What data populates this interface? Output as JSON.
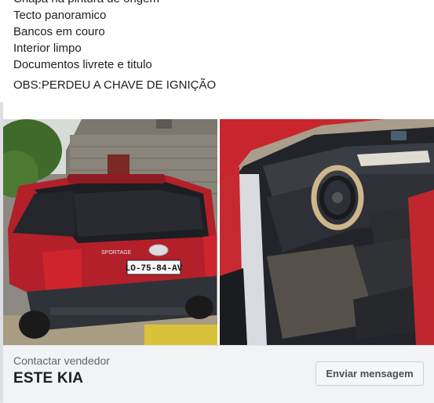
{
  "post": {
    "description_lines": [
      "Chapa na pintura de origem",
      "Tecto panoramico",
      "Bancos em couro",
      "Interior limpo",
      "Documentos livrete e titulo"
    ],
    "obs": "OBS:PERDEU A CHAVE DE IGNIÇÃO"
  },
  "photos": {
    "left": {
      "plate_text": "LO-75-84-AV",
      "badge_text": "SPORTAGE",
      "car_color": "#b3202a"
    },
    "right": {
      "car_color": "#c8262c"
    }
  },
  "footer": {
    "contact_label": "Contactar vendedor",
    "title": "ESTE KIA",
    "send_button_label": "Enviar mensagem"
  }
}
